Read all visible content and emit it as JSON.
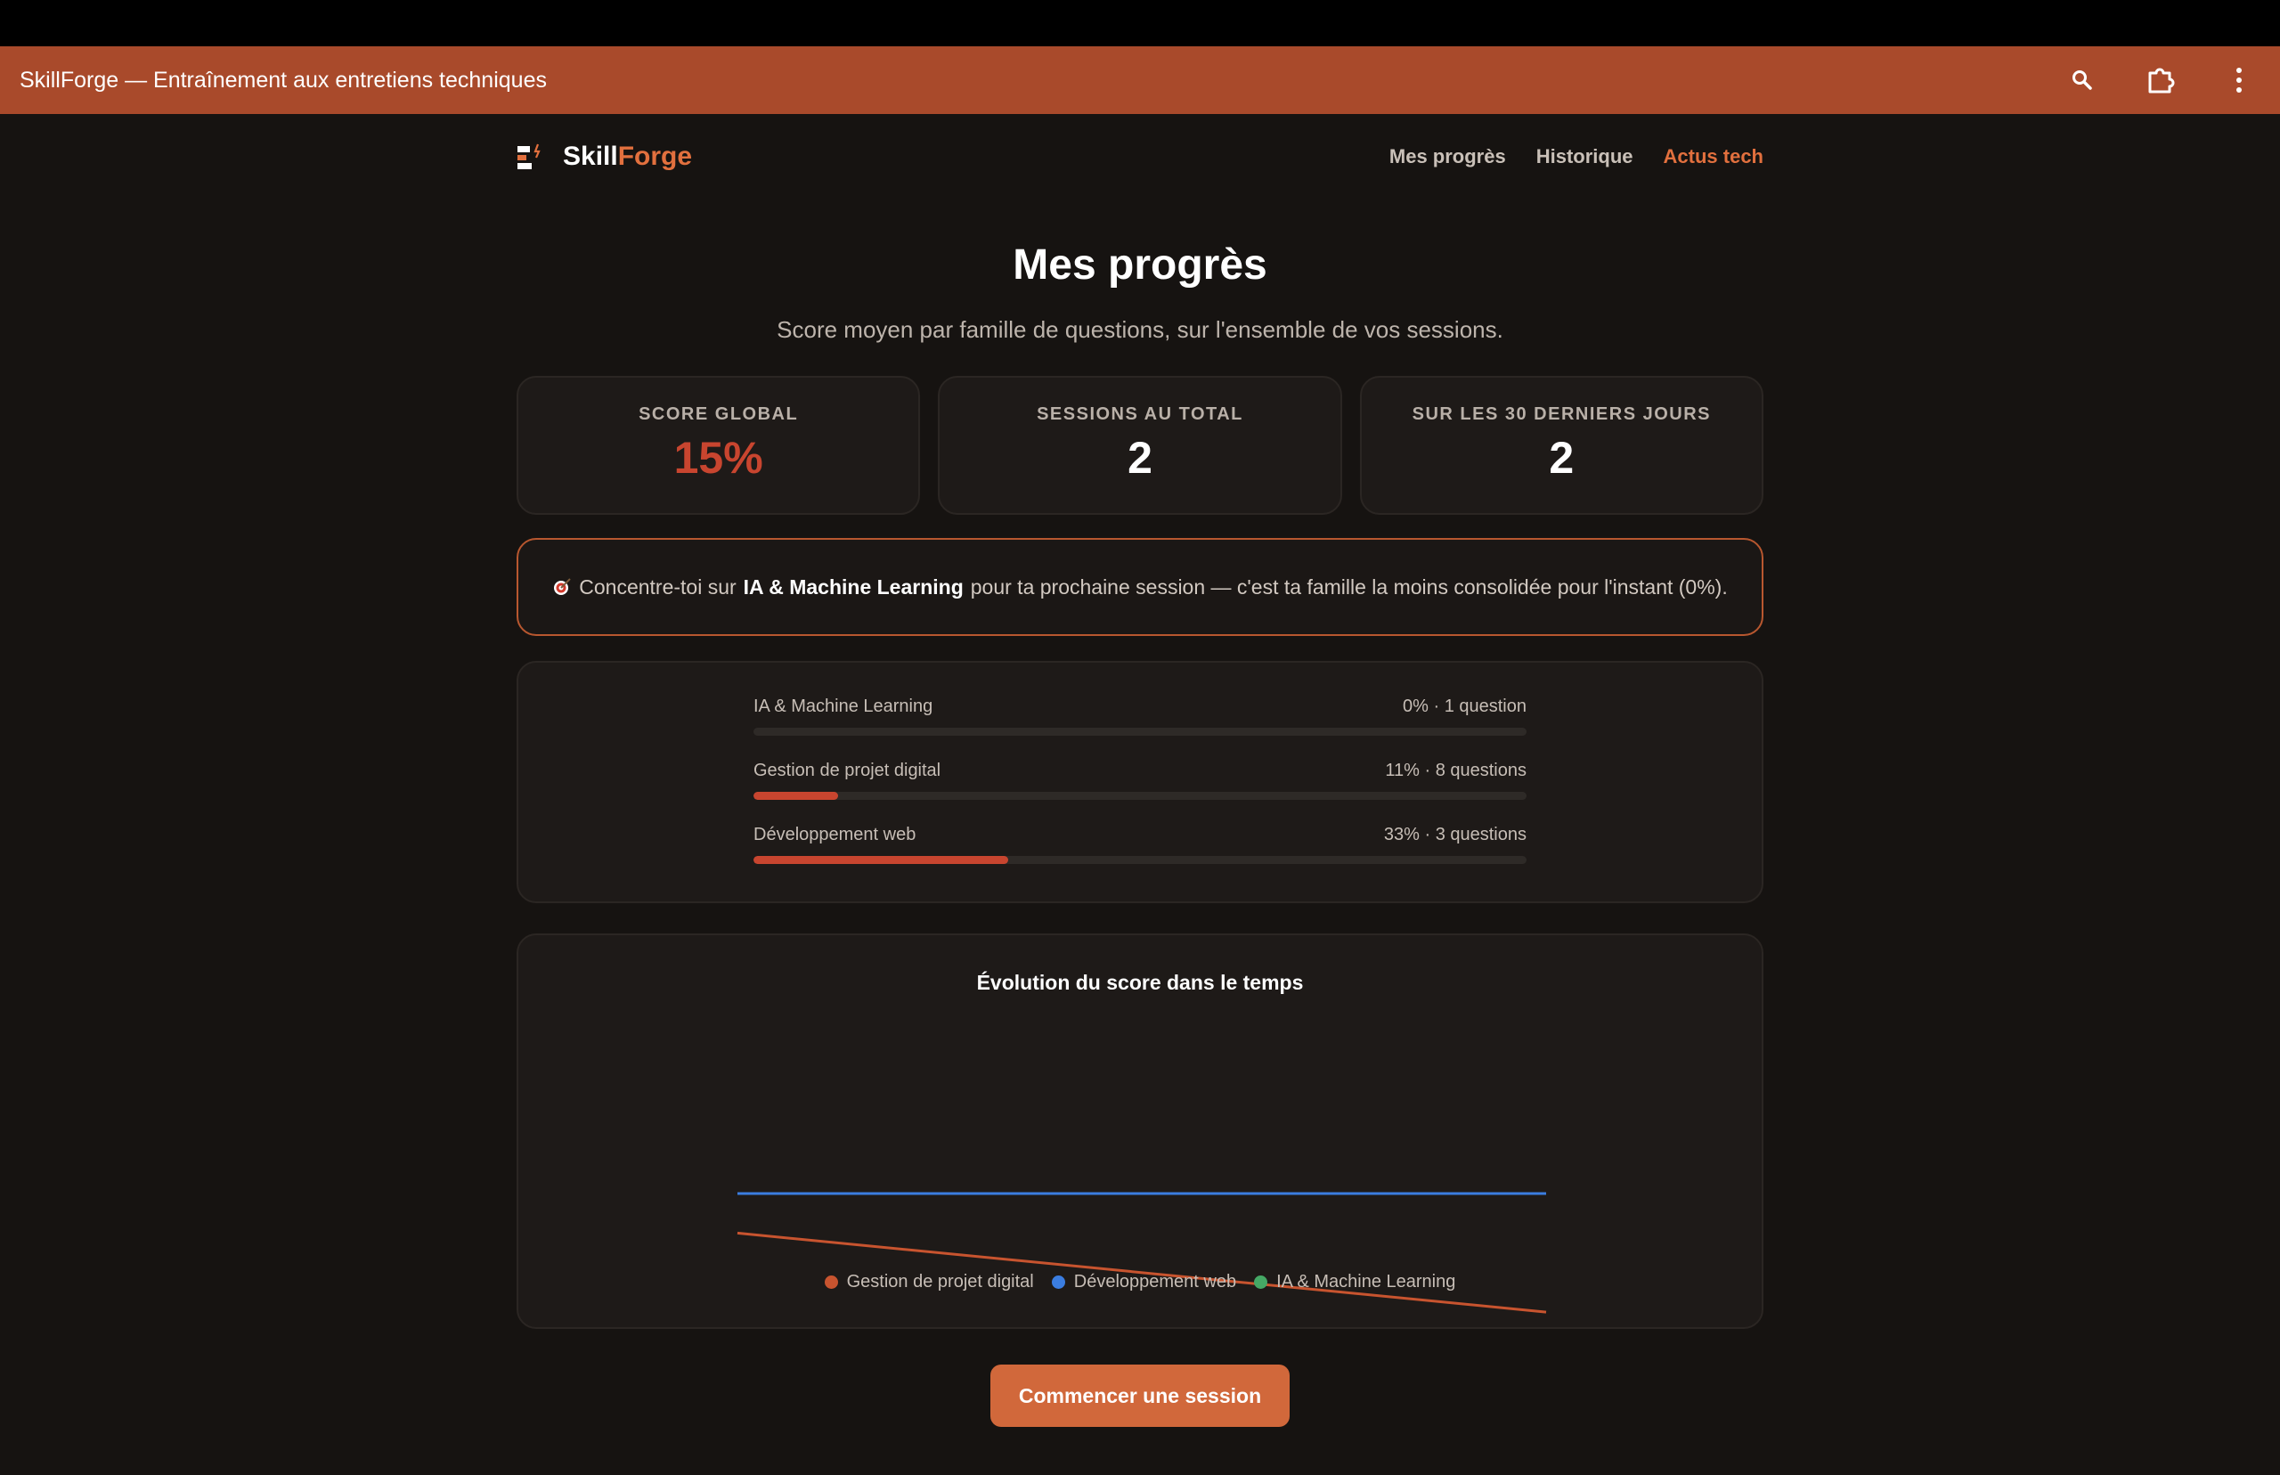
{
  "window": {
    "title": "SkillForge — Entraînement aux entretiens techniques",
    "actions": [
      {
        "name": "search-icon"
      },
      {
        "name": "extensions-icon"
      },
      {
        "name": "more-vertical-icon"
      }
    ]
  },
  "brand": {
    "logo_icon": "skillforge-logo-icon",
    "name_part1": "Skill",
    "name_part2": "Forge",
    "accent_color": "#e2703e"
  },
  "nav": {
    "items": [
      {
        "label": "Mes progrès",
        "active": false
      },
      {
        "label": "Historique",
        "active": false
      },
      {
        "label": "Actus tech",
        "active": true
      }
    ]
  },
  "page": {
    "title": "Mes progrès",
    "subtitle": "Score moyen par famille de questions, sur l'ensemble de vos sessions."
  },
  "stats": [
    {
      "label": "SCORE GLOBAL",
      "value": "15%"
    },
    {
      "label": "SESSIONS AU TOTAL",
      "value": "2"
    },
    {
      "label": "SUR LES 30 DERNIERS JOURS",
      "value": "2"
    }
  ],
  "tip": {
    "icon": "target-icon",
    "prefix": "Concentre-toi sur",
    "family": "IA & Machine Learning",
    "suffix": "pour ta prochaine session — c'est ta famille la moins consolidée pour l'instant (0%)."
  },
  "families": [
    {
      "name": "IA & Machine Learning",
      "meta": "0% · 1 question",
      "percent": 0
    },
    {
      "name": "Gestion de projet digital",
      "meta": "11% · 8 questions",
      "percent": 11
    },
    {
      "name": "Développement web",
      "meta": "33% · 3 questions",
      "percent": 33
    }
  ],
  "chart_data": {
    "type": "line",
    "title": "Évolution du score dans le temps",
    "x": [
      1,
      2
    ],
    "ylim": [
      0,
      100
    ],
    "grid": false,
    "legend_position": "bottom",
    "series": [
      {
        "name": "Gestion de projet digital",
        "color": "#c8542f",
        "values": [
          20,
          2
        ]
      },
      {
        "name": "Développement web",
        "color": "#3b7de0",
        "values": [
          29,
          29
        ]
      },
      {
        "name": "IA & Machine Learning",
        "color": "#45a865",
        "values": []
      }
    ]
  },
  "cta": {
    "label": "Commencer une session"
  }
}
